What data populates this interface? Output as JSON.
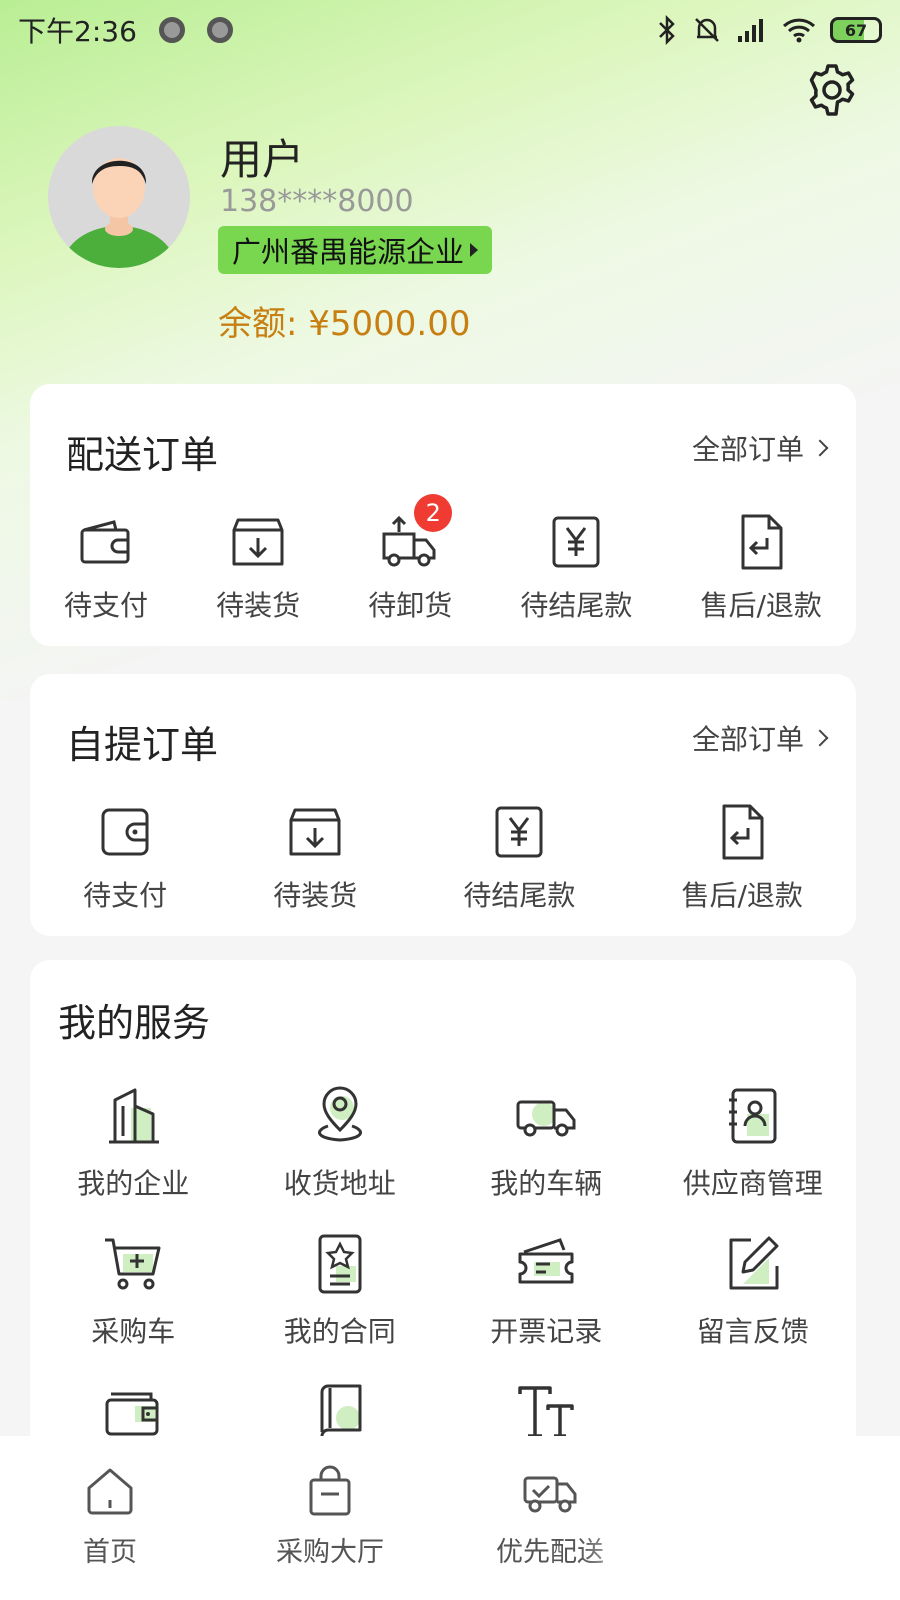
{
  "status_bar": {
    "time": "下午2:36",
    "battery": "67"
  },
  "profile": {
    "name": "用户",
    "phone": "138****8000",
    "company": "广州番禺能源企业",
    "balance_label": "余额: ¥5000.00"
  },
  "delivery_orders": {
    "title": "配送订单",
    "all_link": "全部订单",
    "items": [
      {
        "label": "待支付",
        "icon": "wallet-icon"
      },
      {
        "label": "待装货",
        "icon": "box-down-icon"
      },
      {
        "label": "待卸货",
        "icon": "truck-unload-icon",
        "badge": "2"
      },
      {
        "label": "待结尾款",
        "icon": "yen-icon"
      },
      {
        "label": "售后/退款",
        "icon": "return-doc-icon"
      }
    ]
  },
  "pickup_orders": {
    "title": "自提订单",
    "all_link": "全部订单",
    "items": [
      {
        "label": "待支付",
        "icon": "wallet-icon"
      },
      {
        "label": "待装货",
        "icon": "box-down-icon"
      },
      {
        "label": "待结尾款",
        "icon": "yen-icon"
      },
      {
        "label": "售后/退款",
        "icon": "return-doc-icon"
      }
    ]
  },
  "services": {
    "title": "我的服务",
    "items": [
      {
        "label": "我的企业",
        "icon": "building-icon"
      },
      {
        "label": "收货地址",
        "icon": "location-pin-icon"
      },
      {
        "label": "我的车辆",
        "icon": "truck-icon"
      },
      {
        "label": "供应商管理",
        "icon": "contact-card-icon"
      },
      {
        "label": "采购车",
        "icon": "cart-icon"
      },
      {
        "label": "我的合同",
        "icon": "contract-icon"
      },
      {
        "label": "开票记录",
        "icon": "ticket-icon"
      },
      {
        "label": "留言反馈",
        "icon": "edit-icon"
      },
      {
        "label": "",
        "icon": "wallet-card-icon"
      },
      {
        "label": "",
        "icon": "book-icon"
      },
      {
        "label": "",
        "icon": "font-size-icon"
      }
    ]
  },
  "tabbar": {
    "items": [
      {
        "label": "首页",
        "icon": "home-icon"
      },
      {
        "label": "采购大厅",
        "icon": "shopping-bag-icon"
      },
      {
        "label": "优先配送",
        "icon": "truck-check-icon"
      }
    ]
  },
  "colors": {
    "accent": "#78d64f",
    "balance": "#c77f12",
    "badge": "#ef3b32"
  }
}
